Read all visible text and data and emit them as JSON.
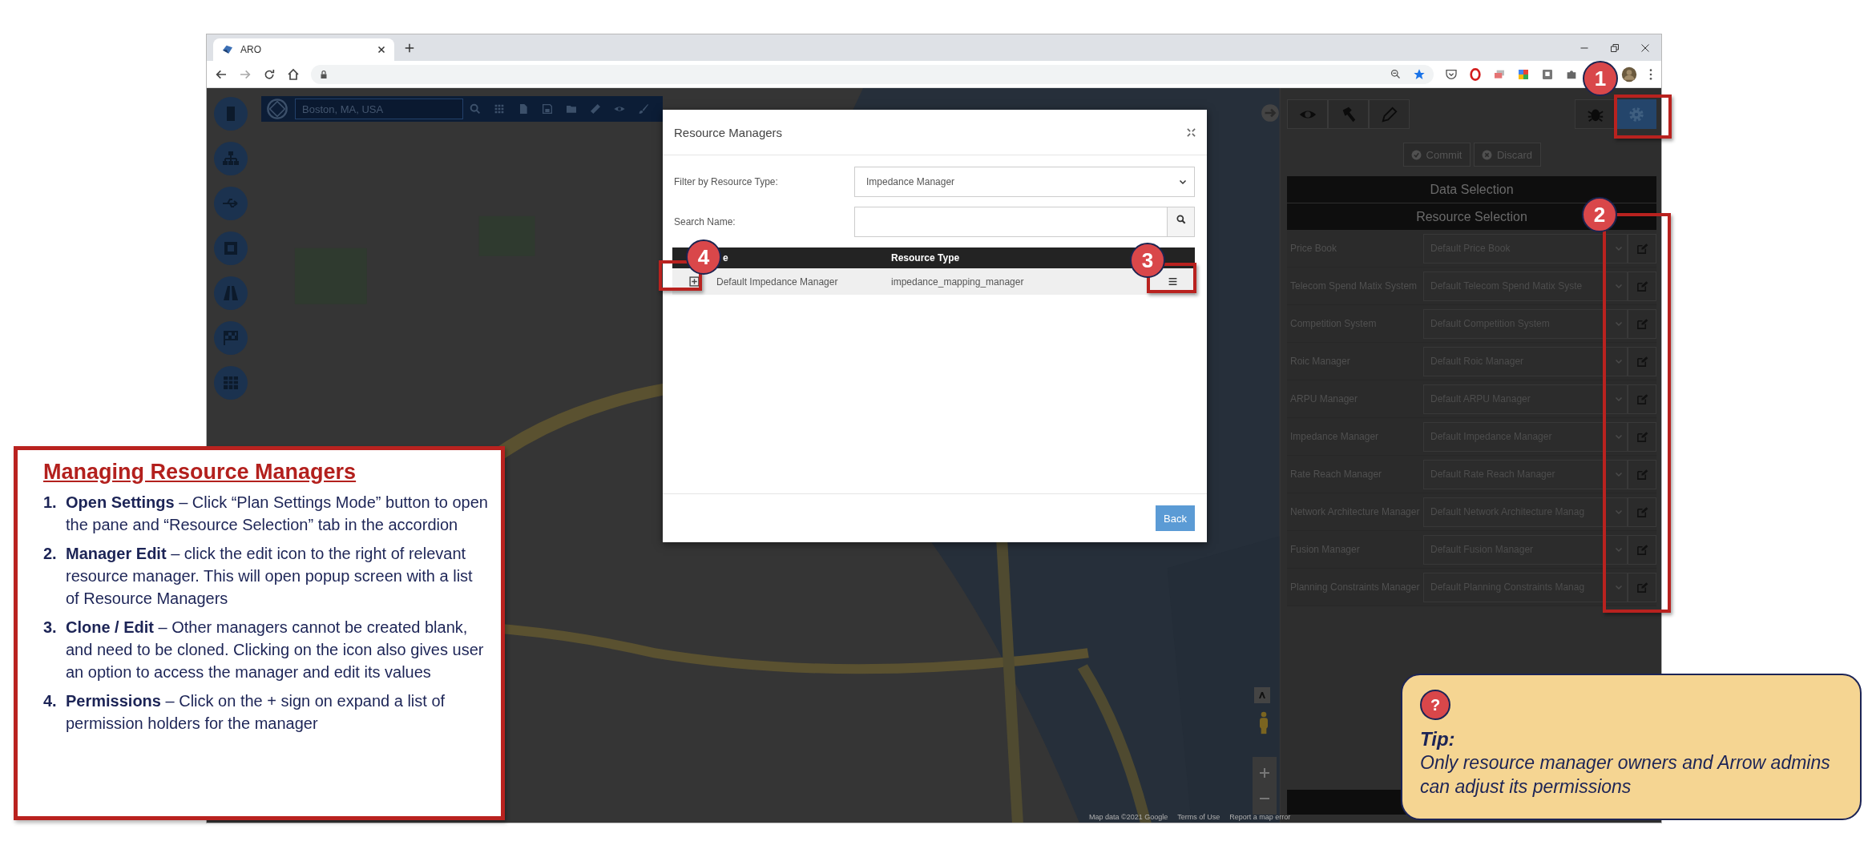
{
  "browser": {
    "tab_title": "ARO"
  },
  "map_search": {
    "value": "Boston, MA, USA"
  },
  "panel": {
    "tools": [
      {
        "kind": "eye",
        "selected": false
      },
      {
        "kind": "hammer",
        "selected": false
      },
      {
        "kind": "pencil",
        "selected": false
      }
    ],
    "modes": [
      {
        "kind": "bug",
        "selected": false
      },
      {
        "kind": "gear",
        "selected": true
      }
    ],
    "actions": [
      "Commit",
      "Discard"
    ],
    "sections": [
      "Data Selection",
      "Resource Selection"
    ],
    "resources": [
      {
        "label": "Price Book",
        "value": "Default Price Book"
      },
      {
        "label": "Telecom Spend Matix System",
        "value": "Default Telecom Spend Matix Syste"
      },
      {
        "label": "Competition System",
        "value": "Default Competition System"
      },
      {
        "label": "Roic Manager",
        "value": "Default Roic Manager"
      },
      {
        "label": "ARPU Manager",
        "value": "Default ARPU Manager"
      },
      {
        "label": "Impedance Manager",
        "value": "Default Impedance Manager"
      },
      {
        "label": "Rate Reach Manager",
        "value": "Default Rate Reach Manager"
      },
      {
        "label": "Network Architecture Manager",
        "value": "Default Network Architecture Manag"
      },
      {
        "label": "Fusion Manager",
        "value": "Default Fusion Manager"
      },
      {
        "label": "Planning Constraints Manager",
        "value": "Default Planning Constraints Manag"
      }
    ]
  },
  "map_attribution": [
    "Map data ©2021 Google",
    "Terms of Use",
    "Report a map error"
  ],
  "dialog": {
    "title": "Resource Managers",
    "filter_label": "Filter by Resource Type:",
    "filter_value": "Impedance Manager",
    "search_label": "Search Name:",
    "table": {
      "columns": [
        "e",
        "Resource Type"
      ],
      "rows": [
        {
          "name": "Default Impedance Manager",
          "type": "impedance_mapping_manager"
        }
      ]
    },
    "back_button": "Back"
  },
  "callouts": [
    "1",
    "2",
    "3",
    "4"
  ],
  "guide": {
    "title": "Managing Resource Managers",
    "steps": [
      {
        "number": "1.",
        "text": "**Open Settings**  – Click “Plan Settings Mode” button to open the pane and “Resource Selection” tab in the accordion"
      },
      {
        "number": "2.",
        "text": "**Manager Edit** – click the edit icon to the right of relevant resource manager. This will open popup screen with a list of Resource Managers"
      },
      {
        "number": "3.",
        "text": "**Clone / Edit** – Other managers cannot be created blank, and need to be cloned. Clicking on the icon also gives user an option to access the manager and edit its values"
      },
      {
        "number": "4.",
        "text": "**Permissions** – Click on the + sign on expand a list of permission holders for the manager"
      }
    ]
  },
  "tip": {
    "icon": "?",
    "title": "Tip:",
    "text": "Only resource manager owners and Arrow admins can adjust its permissions"
  }
}
